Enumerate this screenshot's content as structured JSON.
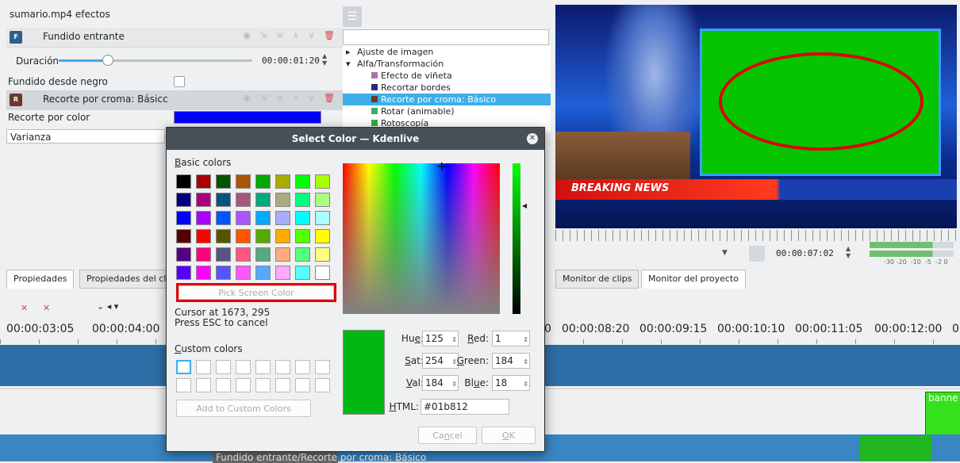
{
  "effects": {
    "panel_title": "sumario.mp4 efectos",
    "effect1": {
      "badge": "F",
      "name": "Fundido entrante"
    },
    "duration_label": "Duración",
    "duration_value": "00:00:01:20",
    "fade_from_black_label": "Fundido desde negro",
    "effect2": {
      "badge": "R",
      "name": "Recorte por croma: Básicc"
    },
    "cut_by_color_label": "Recorte por color",
    "variance_label": "Varianza"
  },
  "tree": {
    "items": [
      "Ajuste de imagen",
      "Alfa/Transformación",
      "Efecto de viñeta",
      "Recortar bordes",
      "Recorte por croma: Básico",
      "Rotar (animable)",
      "Rotoscopía"
    ]
  },
  "monitor": {
    "news_text": "BREAKING NEWS",
    "timecode": "00:00:07:02",
    "meter_labels": "-30 -20  -10  -5  -2 0",
    "tabs": [
      "Monitor de clips",
      "Monitor del proyecto"
    ]
  },
  "left_tabs": [
    "Propiedades",
    "Propiedades del cli"
  ],
  "timeline": {
    "ruler_left": [
      "00:00:03:05",
      "00:00:04:00"
    ],
    "ruler_right": [
      "0",
      "00:00:08:20",
      "00:00:09:15",
      "00:00:10:10",
      "00:00:11:05",
      "00:00:12:00",
      "0"
    ],
    "clip_label": "Fundido entrante/Recorte por croma: Básico",
    "banner_label": "banne"
  },
  "dialog": {
    "title": "Select Color — Kdenlive",
    "basic_colors_label": "Basic colors",
    "basic_colors": [
      "#000000",
      "#aa0000",
      "#005500",
      "#aa5500",
      "#00aa00",
      "#aaaa00",
      "#00ff00",
      "#aaff00",
      "#00007f",
      "#aa007f",
      "#00557f",
      "#aa557f",
      "#00aa7f",
      "#aaaa7f",
      "#00ff7f",
      "#aaff7f",
      "#0000ff",
      "#aa00ff",
      "#0055ff",
      "#aa55ff",
      "#00aaff",
      "#aaaaff",
      "#00ffff",
      "#aaffff",
      "#550000",
      "#ff0000",
      "#555500",
      "#ff5500",
      "#55aa00",
      "#ffaa00",
      "#55ff00",
      "#ffff00",
      "#55007f",
      "#ff007f",
      "#55557f",
      "#ff557f",
      "#55aa7f",
      "#ffaa7f",
      "#55ff7f",
      "#ffff7f",
      "#5500ff",
      "#ff00ff",
      "#5555ff",
      "#ff55ff",
      "#55aaff",
      "#ffaaff",
      "#55ffff",
      "#ffffff"
    ],
    "pick_screen_label": "Pick Screen Color",
    "cursor_text": "Cursor at 1673, 295",
    "esc_text": "Press ESC to cancel",
    "custom_colors_label": "Custom colors",
    "add_custom_label": "Add to Custom Colors",
    "hue_label": "Hue:",
    "hue": "125",
    "sat_label": "Sat:",
    "sat": "254",
    "val_label": "Val:",
    "val": "184",
    "red_label": "Red:",
    "red": "1",
    "green_label": "Green:",
    "green": "184",
    "blue_label": "Blue:",
    "blue": "18",
    "html_label": "HTML:",
    "html": "#01b812",
    "cancel_label": "Cancel",
    "ok_label": "OK",
    "current_color": "#01b812"
  }
}
